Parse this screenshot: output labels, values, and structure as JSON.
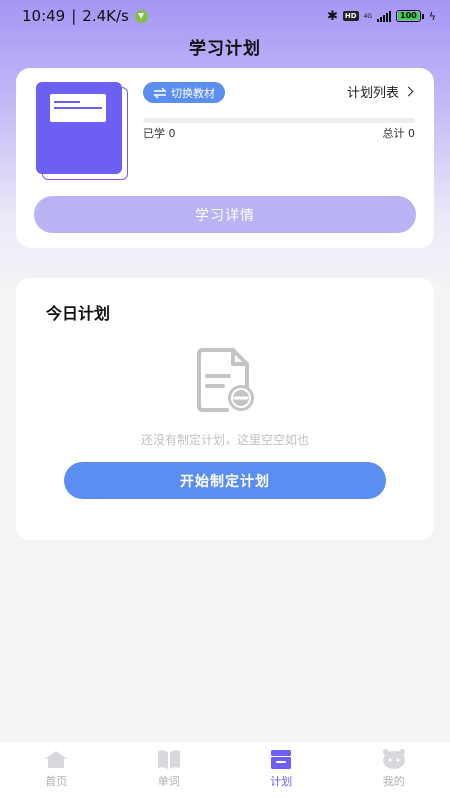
{
  "status_bar": {
    "time": "10:49",
    "speed": "2.4K/s",
    "network": "4G",
    "hd": "HD",
    "battery": "100"
  },
  "header": {
    "title": "学习计划"
  },
  "book_card": {
    "switch_label": "切换教材",
    "plan_list_label": "计划列表",
    "learned_label": "已学",
    "learned_count": "0",
    "total_label": "总计",
    "total_count": "0",
    "progress_fraction": 0,
    "detail_button": "学习详情"
  },
  "today_plan": {
    "title": "今日计划",
    "empty_text": "还没有制定计划，这里空空如也",
    "start_button": "开始制定计划"
  },
  "bottom_nav": {
    "items": [
      {
        "label": "首页",
        "icon": "home-icon",
        "active": false
      },
      {
        "label": "单词",
        "icon": "book-icon",
        "active": false
      },
      {
        "label": "计划",
        "icon": "plan-icon",
        "active": true
      },
      {
        "label": "我的",
        "icon": "profile-icon",
        "active": false
      }
    ]
  },
  "colors": {
    "accent_purple": "#6d5ff2",
    "accent_blue": "#5b8ef0",
    "detail_button_bg": "#b9b3f4"
  }
}
